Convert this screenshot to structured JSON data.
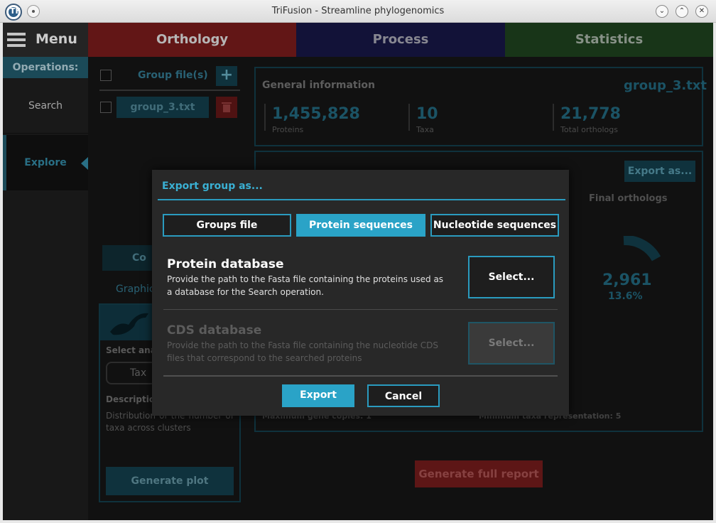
{
  "window": {
    "title": "TriFusion - Streamline phylogenomics",
    "logo_text": "TF"
  },
  "menu": {
    "label": "Menu"
  },
  "tabs": [
    {
      "label": "Orthology"
    },
    {
      "label": "Process"
    },
    {
      "label": "Statistics"
    }
  ],
  "sidebar": {
    "title": "Operations:",
    "items": [
      {
        "label": "Search"
      },
      {
        "label": "Explore"
      }
    ]
  },
  "groups_panel": {
    "header": "Group file(s)",
    "files": [
      {
        "name": "group_3.txt"
      }
    ],
    "partial_tab1": "Co",
    "partial_tab2": "Graphic",
    "select_analysis_label": "Select ana",
    "analysis_value": "Tax",
    "description_title": "Description",
    "description_text": "Distribution of the number of taxa across clusters",
    "generate_plot": "Generate plot"
  },
  "general_info": {
    "title": "General information",
    "group_name": "group_3.txt",
    "stats": [
      {
        "value": "1,455,828",
        "label": "Proteins"
      },
      {
        "value": "10",
        "label": "Taxa"
      },
      {
        "value": "21,778",
        "label": "Total orthologs"
      }
    ]
  },
  "group_panel": {
    "export_as": "Export as...",
    "final_orthologs_title": "Final orthologs",
    "final_value": "2,961",
    "final_percent": "13.6%",
    "max_gene_copies": "Maximum gene copies: 1",
    "min_taxa": "Minimum taxa representation: 5",
    "generate_report": "Generate full report"
  },
  "dialog": {
    "title": "Export group as...",
    "types": [
      {
        "label": "Groups file",
        "active": false
      },
      {
        "label": "Protein sequences",
        "active": true
      },
      {
        "label": "Nucleotide sequences",
        "active": false
      }
    ],
    "protein_db": {
      "title": "Protein database",
      "desc": "Provide the path to the Fasta file containing the proteins used as a database for the Search operation.",
      "button": "Select..."
    },
    "cds_db": {
      "title": "CDS database",
      "desc": "Provide the path to the Fasta file containing the nucleotide CDS files that correspond to the searched proteins",
      "button": "Select...",
      "disabled": true
    },
    "export": "Export",
    "cancel": "Cancel"
  },
  "colors": {
    "accent": "#2aa3c7",
    "orthology_tab": "#701a1a",
    "process_tab": "#151540",
    "statistics_tab": "#1c3d1c",
    "dialog_bg": "#282828",
    "danger": "#c0282a"
  }
}
